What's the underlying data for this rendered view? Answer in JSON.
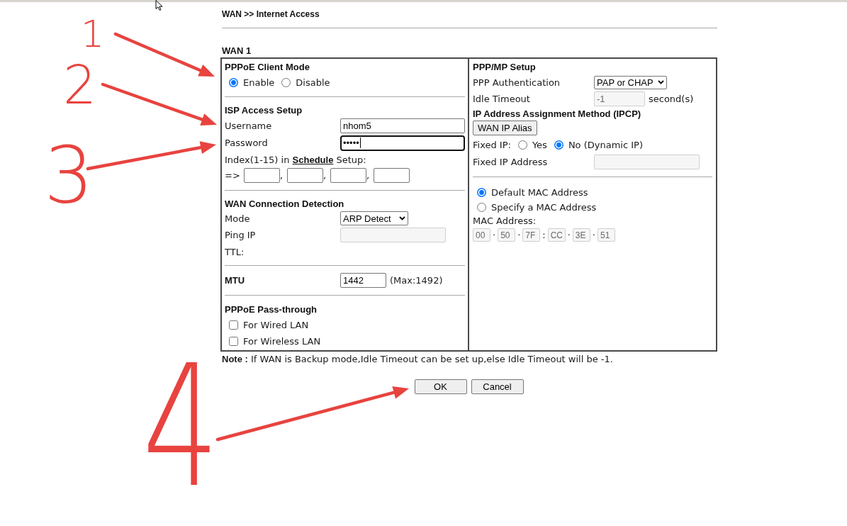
{
  "header": {
    "title": "WAN >> Internet Access"
  },
  "wan": {
    "title": "WAN 1",
    "left": {
      "client_mode": {
        "title": "PPPoE Client Mode",
        "options": [
          {
            "label": "Enable",
            "selected": true
          },
          {
            "label": "Disable",
            "selected": false
          }
        ]
      },
      "isp_access": {
        "title": "ISP Access Setup",
        "username": {
          "label": "Username",
          "value": "nhom5",
          "focused": false
        },
        "password": {
          "label": "Password",
          "value": "•••••",
          "focused": true
        },
        "schedule": {
          "text": "Index(1-15) in",
          "link": "Schedule",
          "text_after": "Setup:",
          "prefix": "=>",
          "separator": ",",
          "fields": [
            {
              "disabled": false
            },
            {
              "disabled": false
            },
            {
              "disabled": false
            },
            {
              "disabled": false
            }
          ]
        }
      },
      "detection": {
        "title": "WAN Connection Detection",
        "mode": {
          "label": "Mode",
          "value": "ARP Detect"
        },
        "ping_ip": {
          "label": "Ping IP",
          "disabled": true
        },
        "ttl": {
          "label": "TTL:"
        }
      },
      "mtu": {
        "label": "MTU",
        "value": "1442",
        "hint": "(Max:1492)"
      },
      "pass_through": {
        "title": "PPPoE Pass-through",
        "options": [
          {
            "label": "For Wired LAN",
            "checked": false
          },
          {
            "label": "For Wireless LAN",
            "checked": false
          }
        ]
      }
    },
    "right": {
      "ppp_mp": {
        "title": "PPP/MP Setup",
        "authentication": {
          "label": "PPP Authentication",
          "value": "PAP or CHAP"
        },
        "idle_timeout": {
          "label": "Idle Timeout",
          "value": "-1",
          "disabled": true,
          "unit": "second(s)"
        }
      },
      "ipcp": {
        "title": "IP Address Assignment Method (IPCP)",
        "alias_button": "WAN IP Alias",
        "fixed_ip": {
          "label": "Fixed IP:",
          "options": [
            {
              "label": "Yes",
              "selected": false
            },
            {
              "label": "No (Dynamic IP)",
              "selected": true
            }
          ]
        },
        "fixed_ip_address": {
          "label": "Fixed IP Address",
          "disabled": true
        }
      },
      "mac": {
        "options": [
          {
            "label": "Default MAC Address",
            "selected": true
          },
          {
            "label": "Specify a MAC Address",
            "selected": false
          }
        ],
        "label": "MAC Address:",
        "octets": [
          {
            "value": "00",
            "disabled": true
          },
          {
            "separator": "·",
            "value": "50",
            "disabled": true
          },
          {
            "separator": "·",
            "value": "7F",
            "disabled": true
          },
          {
            "separator": ":",
            "value": "CC",
            "disabled": true
          },
          {
            "separator": "·",
            "value": "3E",
            "disabled": true
          },
          {
            "separator": "·",
            "value": "51",
            "disabled": true
          }
        ]
      }
    }
  },
  "note": "**Note :** If WAN is Backup mode,Idle Timeout can be set up,else Idle Timeout will be -1.",
  "buttons": [
    "OK",
    "Cancel"
  ],
  "annotations": [
    {
      "label": "1"
    },
    {
      "label": "2"
    },
    {
      "label": "3"
    },
    {
      "label": "4"
    }
  ]
}
